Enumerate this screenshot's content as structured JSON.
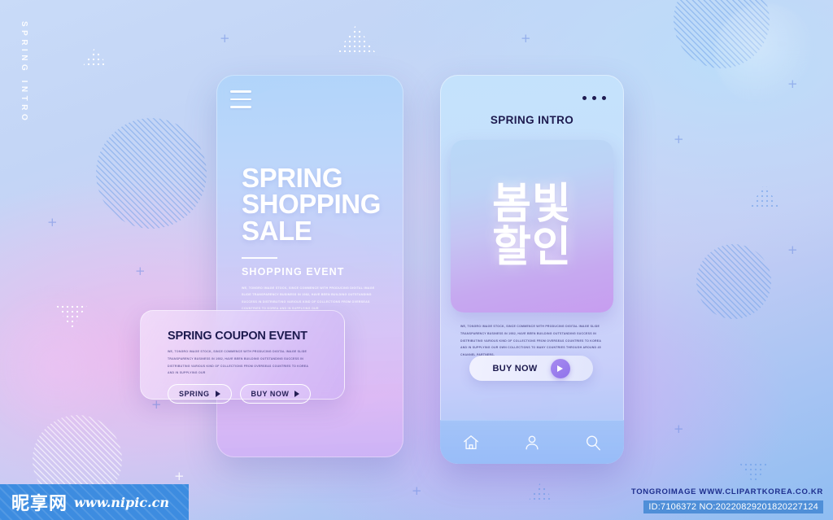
{
  "side_label": "SPRING INTRO",
  "left_phone": {
    "menu_icon": "hamburger-icon",
    "title_line1": "SPRING",
    "title_line2": "SHOPPING",
    "title_line3": "SALE",
    "subtitle": "SHOPPING EVENT",
    "body": "WE, TONGRO IMAGE STOCK, SINCE COMMENCE WITH PRODUCING DIGITAL IMAGE SLIDE TRANSPARENCY BUSINESS IN 1982, HAVE BEEN BUILDING OUTSTANDING SUCCESS IN DISTRIBUTING VARIOUS KIND OF COLLECTIONS FROM OVERSEAS COUNTRIES TO KOREA AND IN SUPPLYING OUR"
  },
  "coupon_card": {
    "title": "SPRING COUPON EVENT",
    "body": "WE, TONGRO IMAGE STOCK, SINCE COMMENCE WITH PRODUCING DIGITAL IMAGE SLIDE TRANSPARENCY BUSINESS IN 1982, HAVE BEEN BUILDING OUTSTANDING SUCCESS IN DISTRIBUTING VARIOUS KIND OF COLLECTIONS FROM OVERSEAS COUNTRIES TO KOREA AND IN SUPPLYING OUR",
    "button_spring": "SPRING",
    "button_buy": "BUY NOW"
  },
  "right_phone": {
    "menu_icon": "more-dots-icon",
    "title": "SPRING INTRO",
    "hero_line1": "봄빛",
    "hero_line2": "할인",
    "body": "WE, TONGRO IMAGE STOCK, SINCE COMMENCE WITH PRODUCING DIGITAL IMAGE SLIDE TRANSPARENCY BUSINESS IN 1982, HAVE BEEN BUILDING OUTSTANDING SUCCESS IN DISTRIBUTING VARIOUS KIND OF COLLECTIONS FROM OVERSEAS COUNTRIES TO KOREA AND IN SUPPLYING OUR OWN COLLECTIONS TO MANY COUNTRIES THROUGH AROUND 45 CHANNEL PARTNERS.",
    "buy_now": "BUY NOW",
    "nav": [
      {
        "icon": "home-icon",
        "label": "Home"
      },
      {
        "icon": "user-icon",
        "label": "Profile"
      },
      {
        "icon": "search-icon",
        "label": "Search"
      }
    ]
  },
  "watermark_left": {
    "brand_cn": "昵享网",
    "url": "www.nipic.cn"
  },
  "watermark_right": {
    "line1": "TONGROIMAGE   WWW.CLIPARTKOREA.CO.KR",
    "line2": "ID:7106372 NO:20220829201820227124"
  },
  "colors": {
    "bg_blue": "#8fbdf2",
    "bg_pink": "#ecbaee",
    "ink": "#1d1a4e",
    "accent_purple": "#8f72ea",
    "watermark_blue": "#3d8ce0"
  }
}
